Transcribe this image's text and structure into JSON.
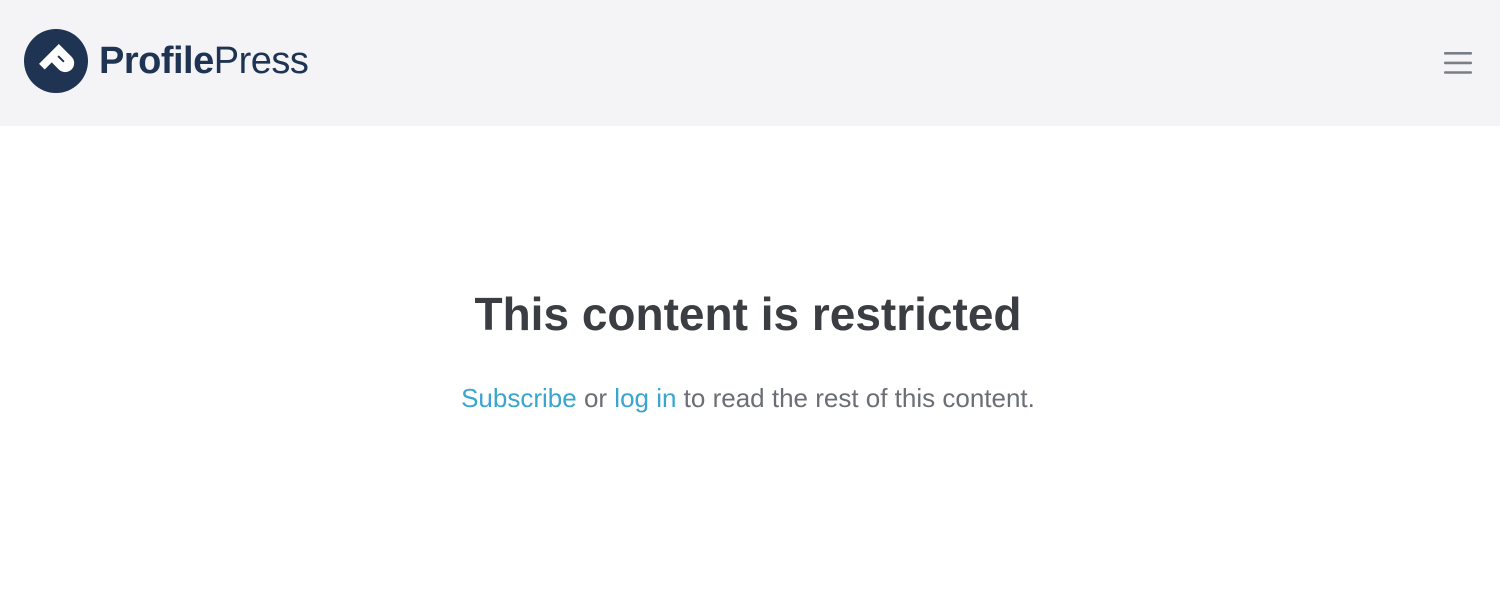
{
  "header": {
    "brand_bold": "Profile",
    "brand_light": "Press",
    "brand_icon": "profilepress-logo-icon",
    "menu_icon": "hamburger-menu-icon"
  },
  "main": {
    "title": "This content is restricted",
    "subscribe_link": "Subscribe",
    "or_text": " or ",
    "login_link": "log in",
    "rest_text": " to read the rest of this content."
  },
  "colors": {
    "header_bg": "#f4f4f6",
    "brand": "#1f3352",
    "link": "#3aa5cf",
    "heading": "#3a3d42",
    "body_text": "#6b6f75"
  }
}
